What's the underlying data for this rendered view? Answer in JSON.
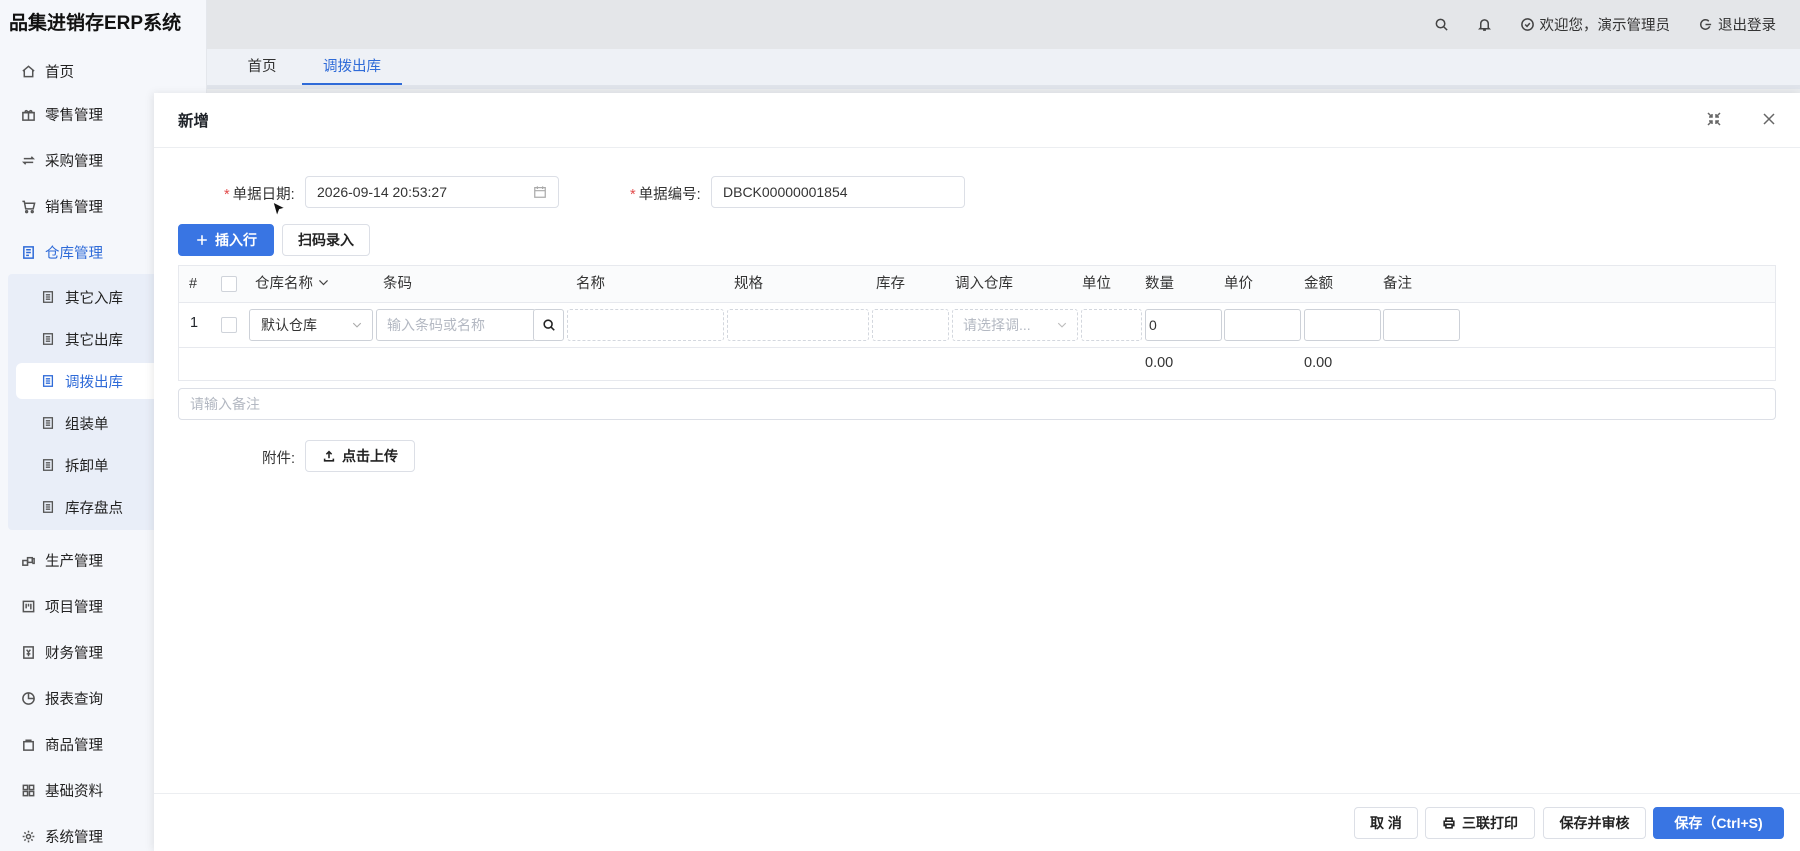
{
  "app": {
    "title": "品集进销存ERP系统"
  },
  "sidebar": {
    "items": [
      {
        "label": "首页",
        "icon": "home-icon"
      },
      {
        "label": "零售管理",
        "icon": "gift-icon"
      },
      {
        "label": "采购管理",
        "icon": "swap-icon"
      },
      {
        "label": "销售管理",
        "icon": "cart-icon"
      },
      {
        "label": "仓库管理",
        "icon": "warehouse-icon"
      },
      {
        "label": "生产管理",
        "icon": "blocks-icon"
      },
      {
        "label": "项目管理",
        "icon": "project-icon"
      },
      {
        "label": "财务管理",
        "icon": "finance-icon"
      },
      {
        "label": "报表查询",
        "icon": "pie-icon"
      },
      {
        "label": "商品管理",
        "icon": "bag-icon"
      },
      {
        "label": "基础资料",
        "icon": "grid-icon"
      },
      {
        "label": "系统管理",
        "icon": "gear-icon"
      }
    ],
    "warehouse_sub": [
      {
        "label": "其它入库"
      },
      {
        "label": "其它出库"
      },
      {
        "label": "调拨出库"
      },
      {
        "label": "组装单"
      },
      {
        "label": "拆卸单"
      },
      {
        "label": "库存盘点"
      }
    ]
  },
  "topbar": {
    "welcome": "欢迎您，演示管理员",
    "logout": "退出登录"
  },
  "tabs": [
    {
      "label": "首页"
    },
    {
      "label": "调拨出库"
    }
  ],
  "modal": {
    "title": "新增",
    "date_label": "单据日期:",
    "date_value": "2026-09-14 20:53:27",
    "number_label": "单据编号:",
    "number_value": "DBCK00000001854",
    "insert_row_label": "插入行",
    "scan_label": "扫码录入",
    "table": {
      "headers": {
        "index": "#",
        "warehouse": "仓库名称",
        "barcode": "条码",
        "name": "名称",
        "spec": "规格",
        "stock": "库存",
        "in_warehouse": "调入仓库",
        "unit": "单位",
        "qty": "数量",
        "price": "单价",
        "amount": "金额",
        "note": "备注"
      },
      "row": {
        "index": "1",
        "warehouse": "默认仓库",
        "barcode_placeholder": "输入条码或名称",
        "in_warehouse_placeholder": "请选择调...",
        "qty": "0"
      },
      "summary": {
        "qty_total": "0.00",
        "amount_total": "0.00"
      }
    },
    "remark_placeholder": "请输入备注",
    "attachment_label": "附件:",
    "upload_label": "点击上传",
    "footer": {
      "cancel": "取 消",
      "print": "三联打印",
      "save_audit": "保存并审核",
      "save": "保存（Ctrl+S)"
    }
  },
  "colors": {
    "accent": "#3975e3",
    "required": "#e24a4a"
  }
}
